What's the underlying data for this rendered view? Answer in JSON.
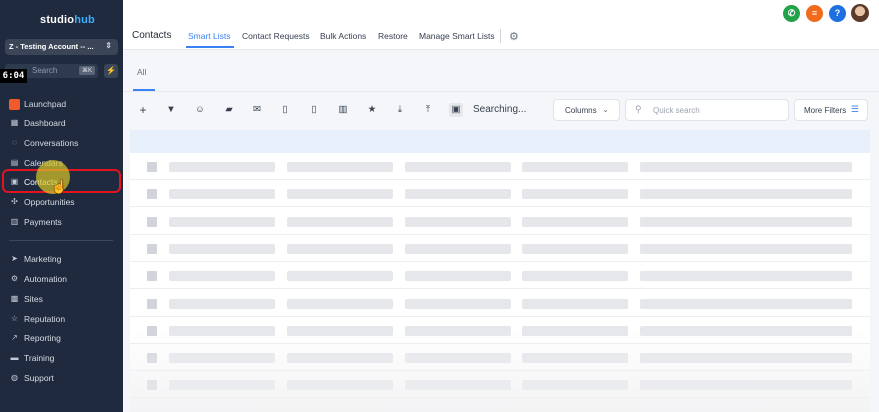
{
  "sidebar": {
    "logo": {
      "part1": "studio",
      "part2": "hub"
    },
    "account": "Z - Testing Account -- ...",
    "search_placeholder": "Search",
    "search_shortcut": "⌘K",
    "timer": "6:04",
    "items": [
      {
        "label": "Launchpad",
        "icon": "rocket-icon"
      },
      {
        "label": "Dashboard",
        "icon": "dashboard-icon"
      },
      {
        "label": "Conversations",
        "icon": "chat-icon"
      },
      {
        "label": "Calendars",
        "icon": "calendar-icon"
      },
      {
        "label": "Contacts",
        "icon": "contacts-icon"
      },
      {
        "label": "Opportunities",
        "icon": "opportunities-icon"
      },
      {
        "label": "Payments",
        "icon": "payments-icon"
      },
      {
        "label": "Marketing",
        "icon": "send-icon"
      },
      {
        "label": "Automation",
        "icon": "automation-icon"
      },
      {
        "label": "Sites",
        "icon": "sites-icon"
      },
      {
        "label": "Reputation",
        "icon": "star-icon"
      },
      {
        "label": "Reporting",
        "icon": "chart-icon"
      },
      {
        "label": "Training",
        "icon": "book-icon"
      },
      {
        "label": "Support",
        "icon": "support-icon"
      }
    ]
  },
  "header": {
    "title": "Contacts",
    "tabs": [
      "Smart Lists",
      "Contact Requests",
      "Bulk Actions",
      "Restore",
      "Manage Smart Lists"
    ],
    "active_tab": "Smart Lists"
  },
  "top_buttons": {
    "phone": {
      "icon": "phone-icon",
      "color": "#22a34a"
    },
    "menu": {
      "icon": "list-icon",
      "color": "#f26a1b"
    },
    "help": {
      "label": "?",
      "color": "#1e6fe0"
    }
  },
  "list": {
    "tab_all": "All",
    "status": "Searching...",
    "columns_label": "Columns",
    "search_placeholder": "Quick search",
    "more_filters": "More Filters"
  },
  "colors": {
    "sidebar_bg": "#1f2a3e",
    "accent": "#3b82f6",
    "highlight": "#e3131f"
  }
}
